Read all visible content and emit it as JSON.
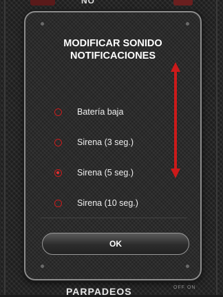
{
  "background_app": {
    "top_label": "NO",
    "bottom_label": "PARPADEOS",
    "bottom_toggle": "OFF ON"
  },
  "dialog": {
    "title_line1": "MODIFICAR SONIDO",
    "title_line2": "NOTIFICACIONES",
    "options": [
      {
        "label": "Batería baja",
        "selected": false
      },
      {
        "label": "Sirena (3 seg.)",
        "selected": false
      },
      {
        "label": "Sirena (5 seg.)",
        "selected": true
      },
      {
        "label": "Sirena (10 seg.)",
        "selected": false
      }
    ],
    "ok_label": "OK"
  },
  "colors": {
    "accent": "#c81e1e",
    "scroll_arrow": "#cc1a1a",
    "dialog_border": "#8c8c8c",
    "text": "#ffffff"
  },
  "icons": {
    "scroll_indicator": "double-arrow-vertical-icon",
    "radio": "radio-button-icon"
  }
}
